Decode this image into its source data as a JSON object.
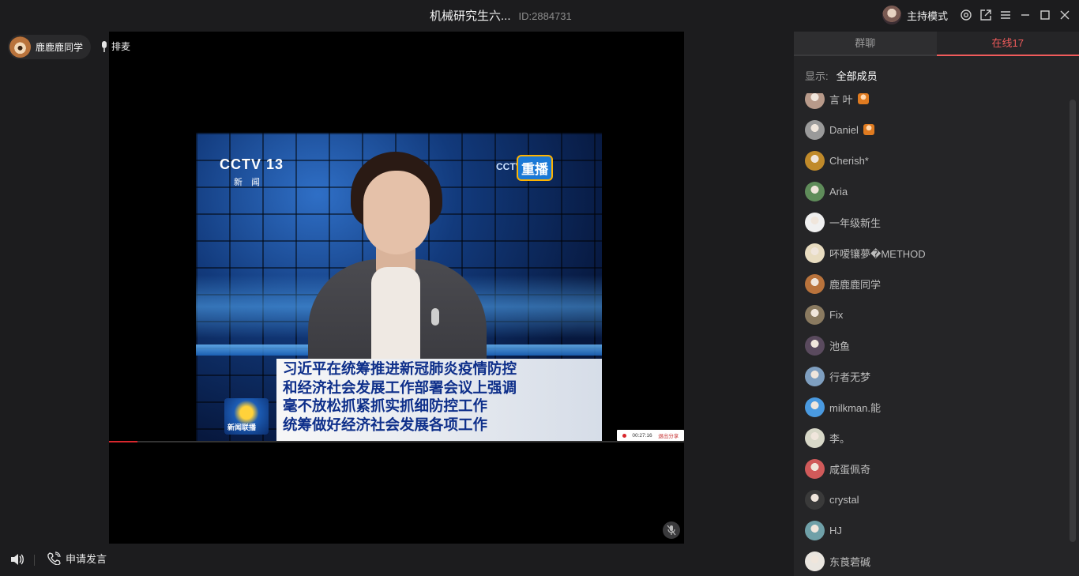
{
  "titlebar": {
    "title": "机械研究生六...",
    "room_id": "ID:2884731",
    "host_mode": "主持模式"
  },
  "left": {
    "user_name": "鹿鹿鹿同学",
    "queue_label": "排麦"
  },
  "video": {
    "channel": "CCTV 13",
    "channel_sub": "新 闻",
    "replay_logo": "CCTV",
    "replay": "重播",
    "program": "新闻联播",
    "caption": [
      "习近平在统筹推进新冠肺炎疫情防控",
      "和经济社会发展工作部署会议上强调",
      "毫不放松抓紧抓实抓细防控工作",
      "统筹做好经济社会发展各项工作"
    ],
    "share_time": "00:27:16",
    "share_exit": "退出分享",
    "progress_fraction": 0.05
  },
  "bottom": {
    "apply_label": "申请发言"
  },
  "panel": {
    "tabs": [
      {
        "label": "群聊",
        "active": false
      },
      {
        "label": "在线17",
        "active": true
      }
    ],
    "filter_label": "显示:",
    "filter_value": "全部成员",
    "members": [
      {
        "name": "言 叶",
        "badge": true,
        "color": "#b89a8a"
      },
      {
        "name": "Daniel",
        "badge": true,
        "color": "#9a9a9a"
      },
      {
        "name": "Cherish*",
        "badge": false,
        "color": "#c08a2a"
      },
      {
        "name": "Aria",
        "badge": false,
        "color": "#5f8c5a"
      },
      {
        "name": "一年级新生",
        "badge": false,
        "color": "#f0f0f0"
      },
      {
        "name": "吥嗳镶夢�METHOD",
        "badge": false,
        "color": "#e8dcc0"
      },
      {
        "name": "鹿鹿鹿同学",
        "badge": false,
        "color": "#b9733c"
      },
      {
        "name": "Fix",
        "badge": false,
        "color": "#8a7a60"
      },
      {
        "name": "池鱼",
        "badge": false,
        "color": "#5a4a5e"
      },
      {
        "name": "行者无梦",
        "badge": false,
        "color": "#7f9fc0"
      },
      {
        "name": "milkman.能",
        "badge": false,
        "color": "#4a9ae0"
      },
      {
        "name": "李。",
        "badge": false,
        "color": "#d8d8c8"
      },
      {
        "name": "咸蛋佩奇",
        "badge": false,
        "color": "#d05a5a"
      },
      {
        "name": "crystal",
        "badge": false,
        "color": "#3a3a3a"
      },
      {
        "name": "HJ",
        "badge": false,
        "color": "#6fa0a8"
      },
      {
        "name": "东莨菪碱",
        "badge": false,
        "color": "#eae6e0"
      }
    ]
  },
  "colors": {
    "accent": "#f15b5b",
    "background": "#1c1c1e",
    "panel": "#252527"
  }
}
